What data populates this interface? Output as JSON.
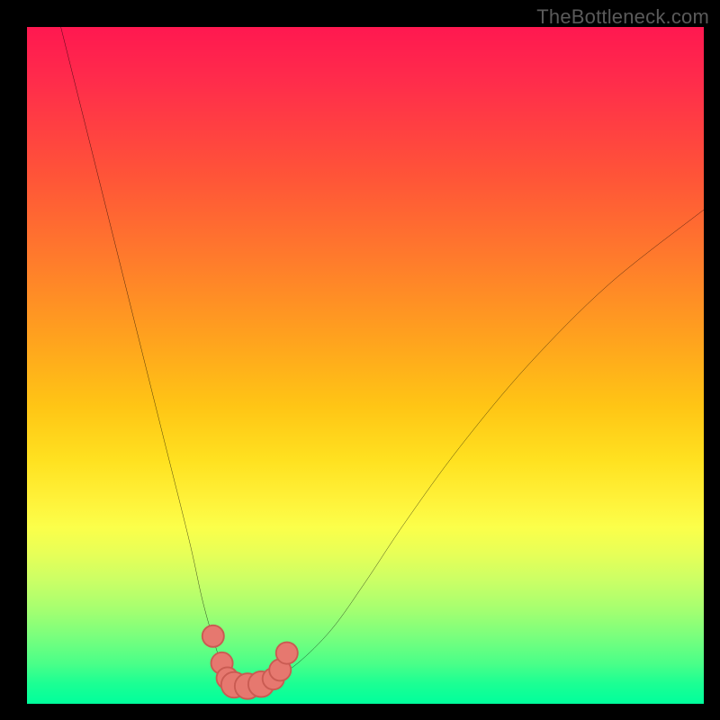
{
  "watermark": "TheBottleneck.com",
  "colors": {
    "frame": "#000000",
    "curve_stroke": "#000000",
    "marker_fill": "#e6786f",
    "marker_stroke": "#c95b52"
  },
  "chart_data": {
    "type": "line",
    "title": "",
    "xlabel": "",
    "ylabel": "",
    "xlim": [
      0,
      100
    ],
    "ylim": [
      0,
      100
    ],
    "series": [
      {
        "name": "curve",
        "x": [
          5,
          8,
          12,
          16,
          20,
          24,
          26,
          28,
          29.5,
          31,
          33,
          36,
          40,
          45,
          50,
          56,
          64,
          74,
          86,
          100
        ],
        "y": [
          100,
          88,
          72,
          56,
          40,
          24,
          15,
          8,
          4,
          2.5,
          2.5,
          3.5,
          6,
          11,
          18,
          27,
          38,
          50,
          62,
          73
        ]
      }
    ],
    "markers": [
      {
        "x": 27.5,
        "y": 10.0,
        "r": 1.6
      },
      {
        "x": 28.8,
        "y": 6.0,
        "r": 1.6
      },
      {
        "x": 29.6,
        "y": 3.8,
        "r": 1.6
      },
      {
        "x": 30.6,
        "y": 2.8,
        "r": 1.9
      },
      {
        "x": 32.6,
        "y": 2.6,
        "r": 1.9
      },
      {
        "x": 34.6,
        "y": 2.9,
        "r": 1.9
      },
      {
        "x": 36.4,
        "y": 3.7,
        "r": 1.6
      },
      {
        "x": 37.4,
        "y": 5.0,
        "r": 1.6
      },
      {
        "x": 38.4,
        "y": 7.5,
        "r": 1.6
      }
    ]
  }
}
